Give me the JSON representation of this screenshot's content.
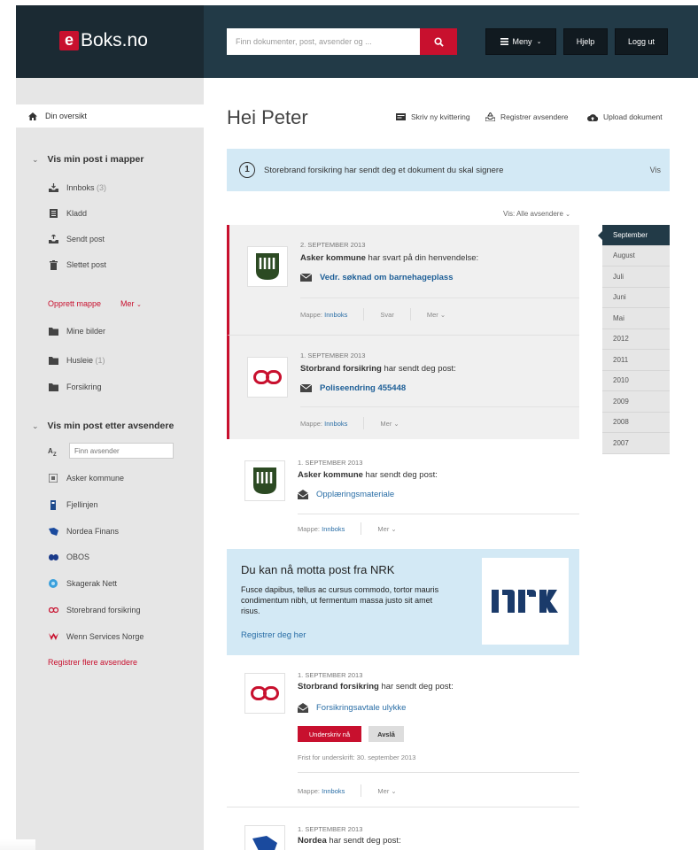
{
  "header": {
    "logo_letter": "e",
    "logo_text": "Boks.no",
    "search_placeholder": "Finn dokumenter, post, avsender og ...",
    "menu_label": "Meny",
    "help_label": "Hjelp",
    "login_label": "Logg ut",
    "brand_red": "#c8102e",
    "header_dark": "#1b2a33"
  },
  "sidebar": {
    "overview": "Din oversikt",
    "folders_heading": "Vis min post i mapper",
    "folders": [
      {
        "icon": "inbox-icon",
        "label": "Innboks",
        "count": "(3)"
      },
      {
        "icon": "draft-icon",
        "label": "Kladd",
        "count": ""
      },
      {
        "icon": "sent-icon",
        "label": "Sendt post",
        "count": ""
      },
      {
        "icon": "trash-icon",
        "label": "Slettet post",
        "count": ""
      }
    ],
    "create_folder": "Opprett mappe",
    "more": "Mer",
    "user_folders": [
      {
        "label": "Mine bilder",
        "count": ""
      },
      {
        "label": "Husleie",
        "count": "(1)"
      },
      {
        "label": "Forsikring",
        "count": ""
      }
    ],
    "senders_heading": "Vis min post etter avsendere",
    "sender_filter_placeholder": "Finn avsender",
    "senders": [
      {
        "icon": "asker-icon",
        "label": "Asker kommune"
      },
      {
        "icon": "fjellinjen-icon",
        "label": "Fjellinjen"
      },
      {
        "icon": "nordea-icon",
        "label": "Nordea Finans"
      },
      {
        "icon": "obos-icon",
        "label": "OBOS"
      },
      {
        "icon": "skagerak-icon",
        "label": "Skagerak Nett"
      },
      {
        "icon": "storebrand-icon",
        "label": "Storebrand forsikring"
      },
      {
        "icon": "wenn-icon",
        "label": "Wenn Services Norge"
      }
    ],
    "register_senders": "Registrer flere avsendere"
  },
  "main": {
    "greeting": "Hei Peter",
    "toolbar": {
      "new_receipt": "Skriv ny kvittering",
      "register_senders": "Registrer avsendere",
      "upload": "Upload dokument"
    },
    "notice": {
      "icon": "1",
      "text": "Storebrand forsikring har sendt deg et dokument du skal signere",
      "link": "Vis"
    },
    "sort_label": "Vis: Alle avsendere"
  },
  "timeline": [
    "September",
    "August",
    "Juli",
    "Juni",
    "Mai",
    "2012",
    "2011",
    "2010",
    "2009",
    "2008",
    "2007"
  ],
  "mails": [
    {
      "date": "2. SEPTEMBER 2013",
      "sender": "Asker kommune",
      "sender_suffix": " har svart på din henvendelse:",
      "subject": "Vedr. søknad om barnehageplass",
      "folder_prefix": "Mappe:",
      "folder": "Innboks",
      "reply": "Svar",
      "more": "Mer"
    },
    {
      "date": "1. SEPTEMBER 2013",
      "sender": "Storbrand forsikring",
      "sender_suffix": " har sendt deg post:",
      "subject": "Poliseendring 455448",
      "folder_prefix": "Mappe:",
      "folder": "Innboks",
      "more": "Mer"
    },
    {
      "date": "1. SEPTEMBER 2013",
      "sender": "Asker kommune",
      "sender_suffix": " har sendt deg post:",
      "subject": "Opplæringsmateriale",
      "folder_prefix": "Mappe:",
      "folder": "Innboks",
      "more": "Mer"
    },
    {
      "date": "1. SEPTEMBER 2013",
      "sender": "Storbrand forsikring",
      "sender_suffix": " har sendt deg post:",
      "subject": "Forsikringsavtale ulykke",
      "sign_label": "Underskriv nå",
      "reject_label": "Avslå",
      "deadline": "Frist for underskrift: 30. september 2013",
      "folder_prefix": "Mappe:",
      "folder": "Innboks",
      "more": "Mer"
    },
    {
      "date": "1. SEPTEMBER 2013",
      "sender": "Nordea",
      "sender_suffix": " har sendt deg post:"
    }
  ],
  "promo": {
    "title": "Du kan nå motta post fra NRK",
    "body": "Fusce dapibus, tellus ac cursus commodo, tortor mauris condimentum nibh, ut fermentum massa justo sit amet risus.",
    "link": "Registrer deg her",
    "logo_text": "NRK"
  }
}
